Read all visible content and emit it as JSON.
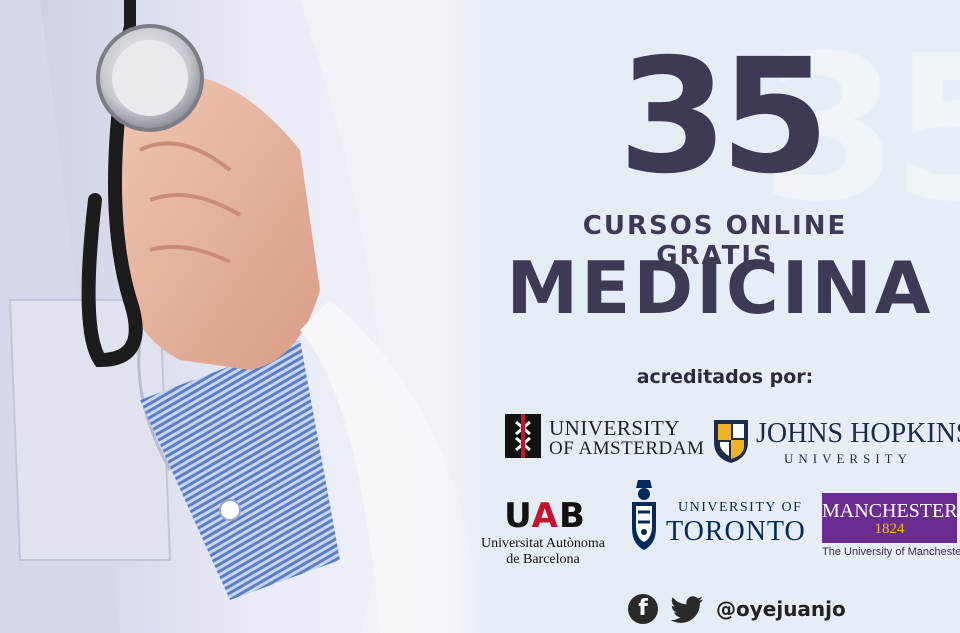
{
  "headline": {
    "number": "35",
    "line1": "CURSOS ONLINE GRATIS",
    "line2": "MEDICINA",
    "credit_label": "acreditados por:"
  },
  "logos": {
    "uva": {
      "line1": "UNIVERSITY",
      "line2": "OF AMSTERDAM",
      "icon": "uva-shield-icon"
    },
    "jhu": {
      "line1": "JOHNS HOPKINS",
      "line2": "UNIVERSITY",
      "icon": "jhu-shield-icon"
    },
    "uab": {
      "mark_u": "U",
      "mark_a": "A",
      "mark_b": "B",
      "line1": "Universitat Autònoma",
      "line2": "de Barcelona"
    },
    "uoft": {
      "line1": "UNIVERSITY OF",
      "line2": "TORONTO",
      "icon": "uoft-crest-icon"
    },
    "manchester": {
      "name": "MANCHESTER",
      "year": "1824",
      "caption": "The University of Manchester"
    }
  },
  "social": {
    "facebook_glyph": "f",
    "handle": "@oyejuanjo"
  },
  "colors": {
    "headline": "#3e3a55",
    "manchester_purple": "#6b2c91",
    "uab_red": "#c8102e"
  }
}
